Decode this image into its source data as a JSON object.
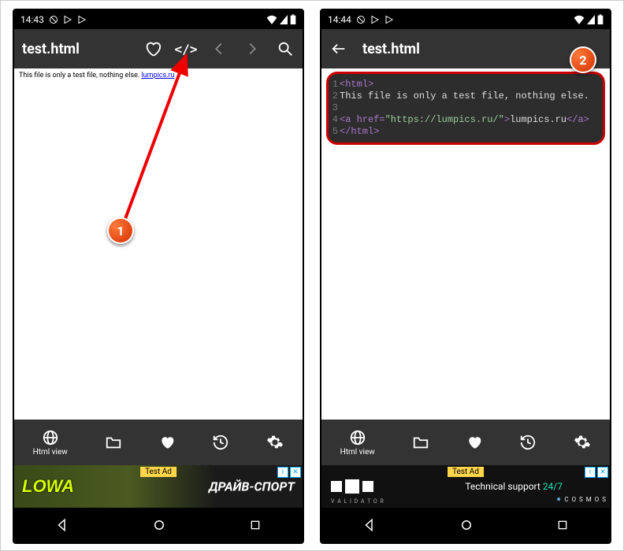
{
  "left": {
    "status_time": "14:43",
    "title": "test.html",
    "rendered_text": "This file is only a test file, nothing else. ",
    "rendered_link": "lumpics.ru"
  },
  "right": {
    "status_time": "14:44",
    "title": "test.html",
    "code": {
      "l1_tag": "<html>",
      "l2_txt": "This file is only a test file, nothing else.",
      "l3_txt": "",
      "l4_a_open": "<a href=",
      "l4_url": "\"https://lumpics.ru/\"",
      "l4_close1": ">",
      "l4_linktxt": "lumpics.ru",
      "l4_close2": "</a>",
      "l5_tag": "</html>"
    }
  },
  "bottombar": {
    "htmlview": "Html view"
  },
  "ads": {
    "tag": "Test Ad",
    "info": "i",
    "close": "✕",
    "lowa": "LOWA",
    "drive": "ДРАЙВ-СПОРТ",
    "p2p_sub": "V A L I D A T O R",
    "p2p_text1": "Technical support ",
    "p2p_text2": "24/7",
    "cosmos": "C O S M O S"
  },
  "callouts": {
    "one": "1",
    "two": "2"
  }
}
